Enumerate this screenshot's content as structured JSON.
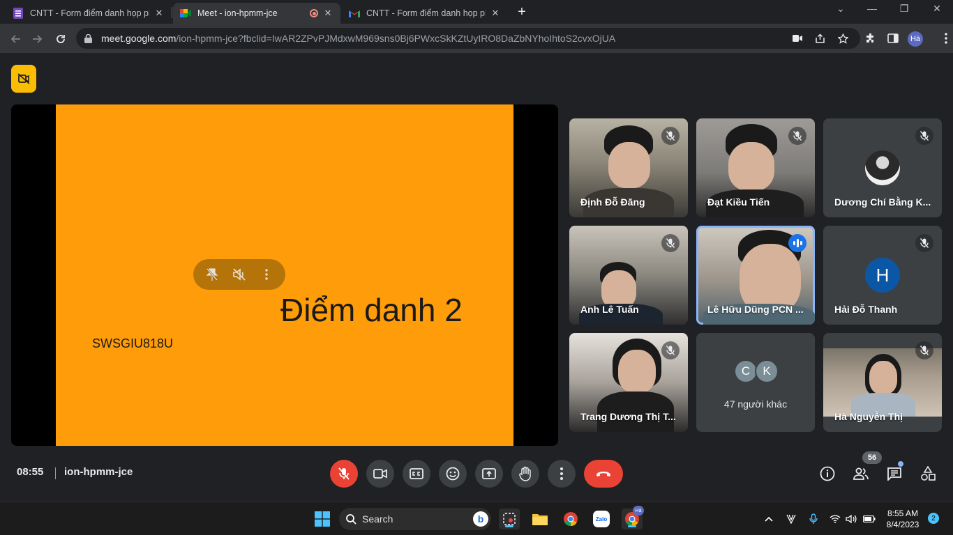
{
  "browser": {
    "tabs": [
      {
        "title": "CNTT - Form điểm danh họp phụ",
        "active": false
      },
      {
        "title": "Meet - ion-hpmm-jce",
        "active": true
      },
      {
        "title": "CNTT - Form điểm danh họp phụ",
        "active": false
      }
    ],
    "url_host": "meet.google.com",
    "url_rest": "/ion-hpmm-jce?fbclid=IwAR2ZPvPJMdxwM969sns0Bj6PWxcSkKZtUyIRO8DaZbNYhoIhtoS2cvxOjUA",
    "profile_initials": "Hà"
  },
  "presentation": {
    "slide_title": "Điểm danh 2",
    "slide_code": "SWSGIU818U"
  },
  "participants": [
    {
      "name": "Định Đỗ Đăng",
      "muted": true
    },
    {
      "name": "Đạt Kiều Tiến",
      "muted": true
    },
    {
      "name": "Dương Chí Bằng K...",
      "muted": true
    },
    {
      "name": "Anh Lê Tuấn",
      "muted": true
    },
    {
      "name": "Lê Hữu Dũng PCN ...",
      "speaking": true
    },
    {
      "name": "Hải Đỗ Thanh",
      "muted": true,
      "avatar_letter": "H"
    },
    {
      "name": "Trang Dương Thị T...",
      "muted": true
    },
    {
      "name": "Hà Nguyễn Thị",
      "muted": true
    }
  ],
  "others": {
    "avatars": [
      "C",
      "K"
    ],
    "label": "47 người khác"
  },
  "bottom_bar": {
    "time": "08:55",
    "meeting_code": "ion-hpmm-jce",
    "participant_count": "56"
  },
  "taskbar": {
    "search_label": "Search",
    "time": "8:55 AM",
    "date": "8/4/2023",
    "notifications": "2",
    "chrome_badge": "Hà"
  },
  "colors": {
    "slide_bg": "#ff9c0a",
    "end_call": "#ea4335",
    "speaking_outline": "#8ab4f8",
    "hide_self_button": "#fbbc04"
  }
}
